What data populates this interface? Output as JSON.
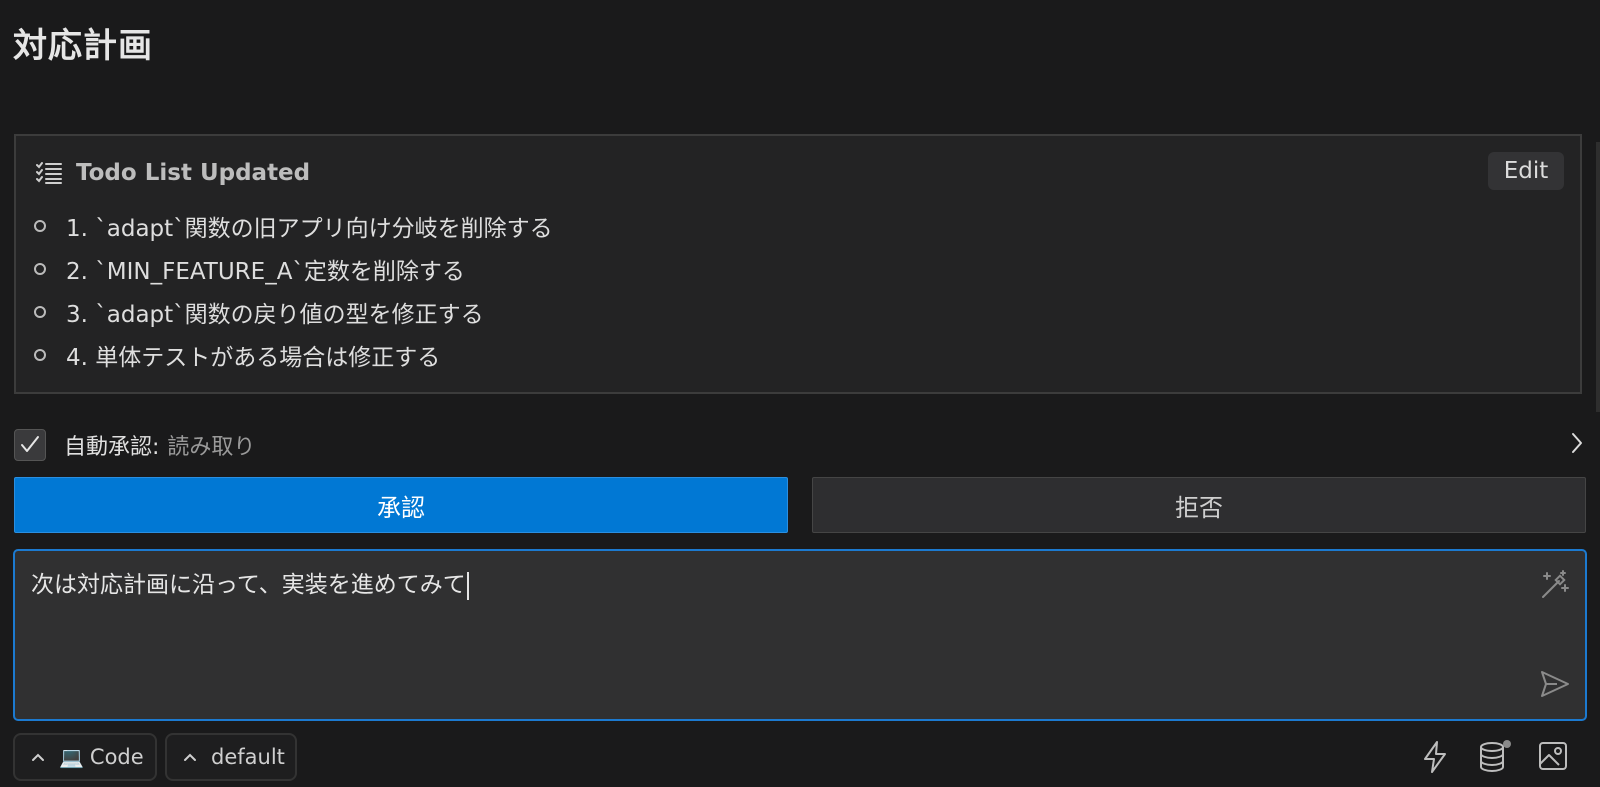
{
  "page": {
    "title": "対応計画"
  },
  "todo": {
    "header": "Todo List Updated",
    "edit_label": "Edit",
    "items": [
      "1. `adapt`関数の旧アプリ向け分岐を削除する",
      "2. `MIN_FEATURE_A`定数を削除する",
      "3. `adapt`関数の戻り値の型を修正する",
      "4. 単体テストがある場合は修正する"
    ]
  },
  "auto_approve": {
    "label": "自動承認:",
    "value": "読み取り",
    "checked": true
  },
  "actions": {
    "approve_label": "承認",
    "reject_label": "拒否",
    "approve_color": "#0178d4"
  },
  "composer": {
    "value": "次は対応計画に沿って、実装を進めてみて"
  },
  "footer": {
    "mode_label": "Code",
    "mode_icon": "laptop-icon",
    "profile_label": "default",
    "icons": [
      "lightning-icon",
      "database-icon",
      "image-icon"
    ]
  },
  "colors": {
    "accent": "#1c7ad0",
    "background": "#1a1a1b"
  }
}
